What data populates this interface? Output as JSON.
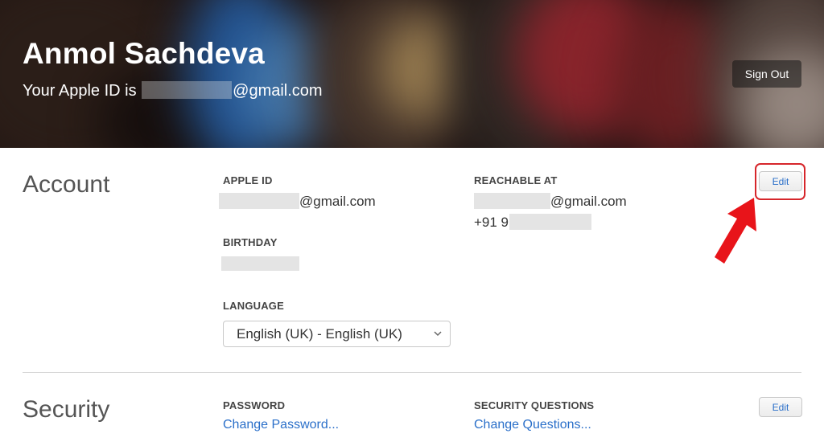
{
  "header": {
    "name": "Anmol Sachdeva",
    "apple_id_prefix": "Your Apple ID is",
    "apple_id_suffix": "@gmail.com",
    "sign_out_label": "Sign Out"
  },
  "account": {
    "title": "Account",
    "edit_label": "Edit",
    "apple_id_label": "APPLE ID",
    "apple_id_suffix": "@gmail.com",
    "reachable_label": "REACHABLE AT",
    "reachable_email_suffix": "@gmail.com",
    "reachable_phone_prefix": "+91 9",
    "birthday_label": "BIRTHDAY",
    "language_label": "LANGUAGE",
    "language_value": "English (UK) - English (UK)"
  },
  "security": {
    "title": "Security",
    "edit_label": "Edit",
    "password_label": "PASSWORD",
    "password_link": "Change Password...",
    "questions_label": "SECURITY QUESTIONS",
    "questions_link": "Change Questions..."
  },
  "annotation": {
    "highlight_color": "#d6262b",
    "arrow_color": "#e8141a"
  },
  "colors": {
    "link": "#2a6fc9",
    "section_title": "#555555"
  }
}
